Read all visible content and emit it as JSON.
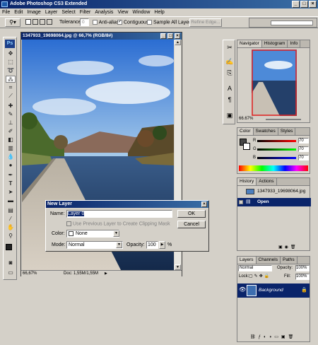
{
  "app": {
    "title": "Adobe Photoshop CS3 Extended",
    "win_min": "_",
    "win_max": "□",
    "win_close": "×"
  },
  "menu": [
    "File",
    "Edit",
    "Image",
    "Layer",
    "Select",
    "Filter",
    "Analysis",
    "View",
    "Window",
    "Help"
  ],
  "options": {
    "tolerance_label": "Tolerance:",
    "tolerance_value": "0",
    "antialias_label": "Anti-alias",
    "contiguous_label": "Contiguous",
    "sample_all_label": "Sample All Layers",
    "refine_label": "Refine Edge..."
  },
  "toolbox": {
    "logo": "Ps"
  },
  "document": {
    "title": "1347933_19698064.jpg @ 66,7% (RGB/8#)",
    "zoom": "66,67%",
    "doc_size": "Doc: 1,55M/1,55M"
  },
  "navigator": {
    "tabs": [
      "Navigator",
      "Histogram",
      "Info"
    ],
    "zoom": "66.67%"
  },
  "color_panel": {
    "tabs": [
      "Color",
      "Swatches",
      "Styles"
    ],
    "r_label": "R",
    "g_label": "G",
    "b_label": "B",
    "r_value": "70",
    "g_value": "70",
    "b_value": "70"
  },
  "history": {
    "tabs": [
      "History",
      "Actions"
    ],
    "snapshot": "1347933_19698064.jpg",
    "items": [
      "Open"
    ]
  },
  "layers": {
    "tabs": [
      "Layers",
      "Channels",
      "Paths"
    ],
    "blend_mode": "Normal",
    "opacity_label": "Opacity:",
    "opacity_value": "100%",
    "lock_label": "Lock:",
    "fill_label": "Fill:",
    "fill_value": "100%",
    "layer_name": "Background",
    "footer_icons": [
      "link-icon",
      "fx-icon",
      "mask-icon",
      "adjustment-icon",
      "group-icon",
      "new-layer-icon",
      "trash-icon"
    ]
  },
  "dialog": {
    "title": "New Layer",
    "name_label": "Name:",
    "name_value": "Layer 0",
    "clip_label": "Use Previous Layer to Create Clipping Mask",
    "color_label": "Color:",
    "color_value": "None",
    "mode_label": "Mode:",
    "mode_value": "Normal",
    "opacity_label": "Opacity:",
    "opacity_value": "100",
    "opacity_unit": "%",
    "ok_label": "OK",
    "cancel_label": "Cancel",
    "close": "×"
  }
}
